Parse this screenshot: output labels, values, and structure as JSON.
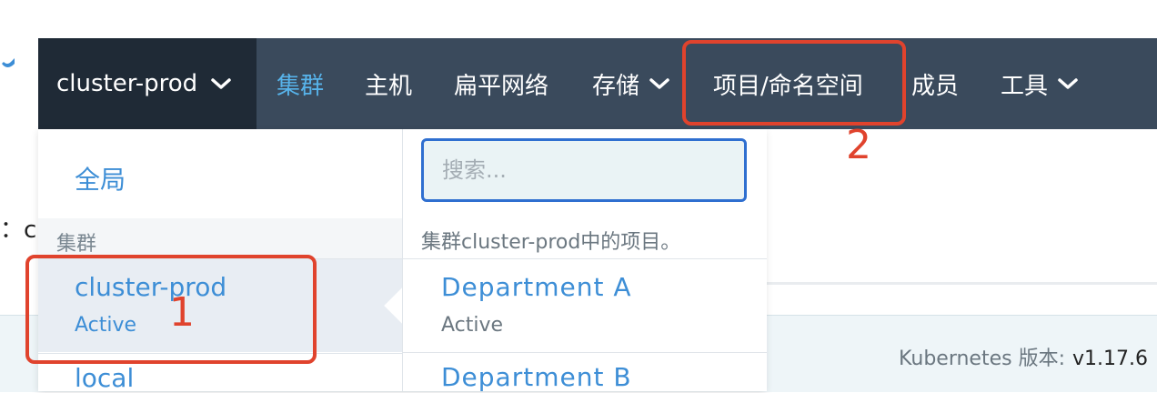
{
  "topnav": {
    "cluster_name": "cluster-prod",
    "items": [
      {
        "label": "集群"
      },
      {
        "label": "主机"
      },
      {
        "label": "扁平网络"
      },
      {
        "label": "存储"
      },
      {
        "label": "项目/命名空间"
      },
      {
        "label": "成员"
      },
      {
        "label": "工具"
      }
    ]
  },
  "dropdown": {
    "global_label": "全局",
    "cluster_section_label": "集群",
    "clusters": [
      {
        "name": "cluster-prod",
        "status": "Active"
      },
      {
        "name": "local"
      }
    ],
    "search_placeholder": "搜索...",
    "projects_header": "集群cluster-prod中的项目。",
    "projects": [
      {
        "name": "Department A",
        "status": "Active"
      },
      {
        "name": "Department B"
      }
    ]
  },
  "background": {
    "colon_text": "：c",
    "k8s_label": "Kubernetes 版本:",
    "k8s_version": "v1.17.6"
  },
  "annotations": {
    "one": "1",
    "two": "2"
  },
  "colors": {
    "nav_bg": "#3a4a5c",
    "nav_dark": "#1f2a36",
    "accent_link": "#3d8ed6",
    "active_nav": "#57b3ea",
    "annotation_red": "#e0432d"
  }
}
